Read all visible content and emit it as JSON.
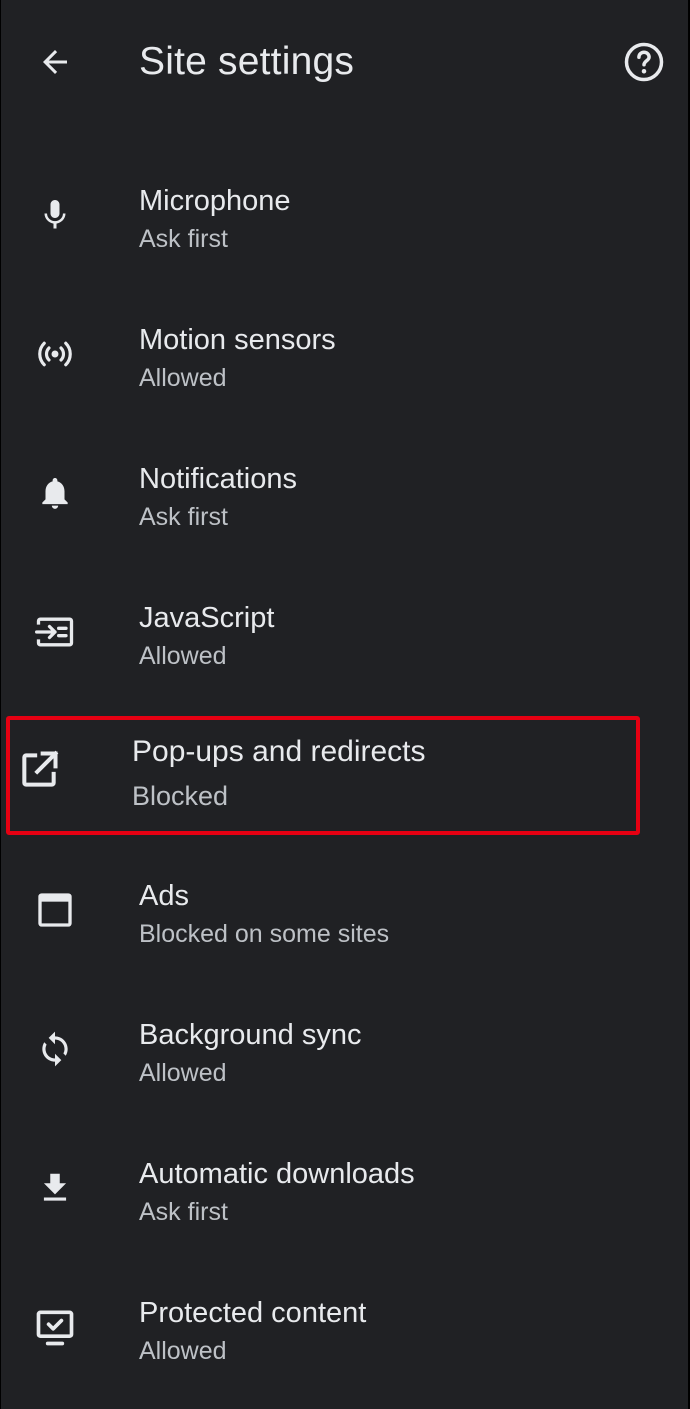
{
  "header": {
    "title": "Site settings",
    "back_icon": "arrow-left-icon",
    "help_icon": "help-circle-icon"
  },
  "colors": {
    "background": "#202124",
    "text_primary": "#e8eaed",
    "text_secondary": "#bdc1c6",
    "highlight": "#e60012"
  },
  "items": [
    {
      "title": "Microphone",
      "status": "Ask first",
      "icon": "microphone-icon"
    },
    {
      "title": "Motion sensors",
      "status": "Allowed",
      "icon": "motion-sensor-icon"
    },
    {
      "title": "Notifications",
      "status": "Ask first",
      "icon": "bell-icon"
    },
    {
      "title": "JavaScript",
      "status": "Allowed",
      "icon": "javascript-icon"
    },
    {
      "title": "Pop-ups and redirects",
      "status": "Blocked",
      "icon": "open-in-new-icon",
      "highlighted": true
    },
    {
      "title": "Ads",
      "status": "Blocked on some sites",
      "icon": "ads-window-icon"
    },
    {
      "title": "Background sync",
      "status": "Allowed",
      "icon": "sync-icon"
    },
    {
      "title": "Automatic downloads",
      "status": "Ask first",
      "icon": "download-icon"
    },
    {
      "title": "Protected content",
      "status": "Allowed",
      "icon": "protected-content-icon"
    }
  ]
}
